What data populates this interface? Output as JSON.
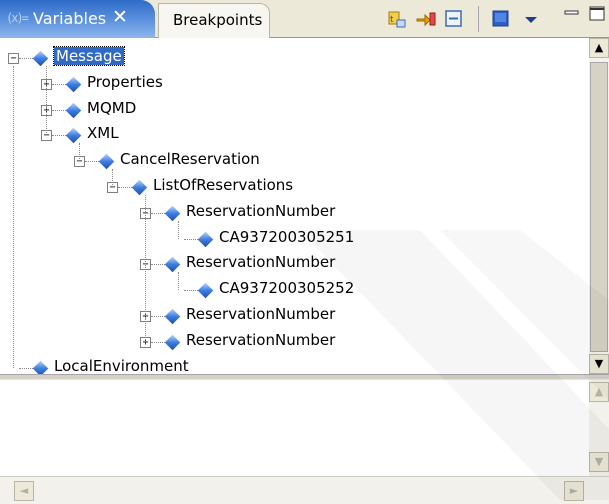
{
  "tabs": {
    "active_label": "Variables",
    "active_close": "✕",
    "inactive_label": "Breakpoints"
  },
  "toolbar": {
    "buttons": [
      {
        "icon": "show-type-names-icon"
      },
      {
        "icon": "change-value-icon"
      },
      {
        "icon": "collapse-all-icon"
      },
      {
        "icon": "maximize-detail-icon"
      },
      {
        "icon": "view-menu-chevron-icon"
      },
      {
        "icon": "minimize-icon"
      },
      {
        "icon": "maximize-icon"
      }
    ]
  },
  "tree": {
    "nodes": [
      {
        "label": "Message",
        "level": 0,
        "expander": "minus",
        "selected": true
      },
      {
        "label": "Properties",
        "level": 1,
        "expander": "plus"
      },
      {
        "label": "MQMD",
        "level": 1,
        "expander": "plus"
      },
      {
        "label": "XML",
        "level": 1,
        "expander": "minus"
      },
      {
        "label": "CancelReservation",
        "level": 2,
        "expander": "minus"
      },
      {
        "label": "ListOfReservations",
        "level": 3,
        "expander": "minus"
      },
      {
        "label": "ReservationNumber",
        "level": 4,
        "expander": "minus"
      },
      {
        "label": "CA937200305251",
        "level": 5,
        "expander": "none"
      },
      {
        "label": "ReservationNumber",
        "level": 4,
        "expander": "minus"
      },
      {
        "label": "CA937200305252",
        "level": 5,
        "expander": "none"
      },
      {
        "label": "ReservationNumber",
        "level": 4,
        "expander": "plus"
      },
      {
        "label": "ReservationNumber",
        "level": 4,
        "expander": "plus"
      },
      {
        "label": "LocalEnvironment",
        "level": 0,
        "expander": "none"
      }
    ]
  },
  "scroll": {
    "up": "▲",
    "down": "▼",
    "left": "◄",
    "right": "►"
  },
  "colors": {
    "selection": "#316ac5",
    "tab_active": "#4f83d3",
    "node_icon": "#3d7de0"
  }
}
